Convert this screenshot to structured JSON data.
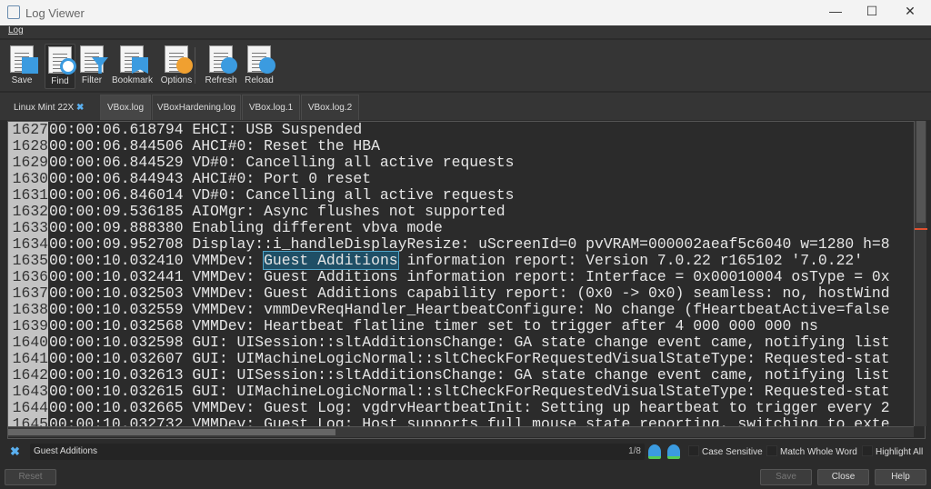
{
  "window": {
    "title": "Log Viewer",
    "minimize": "—",
    "maximize": "☐",
    "close": "✕"
  },
  "menu": {
    "log": "Log"
  },
  "toolbar": {
    "save": "Save",
    "find": "Find",
    "filter": "Filter",
    "bookmark": "Bookmark",
    "options": "Options",
    "refresh": "Refresh",
    "reload": "Reload"
  },
  "vm_name": "Linux Mint 22X",
  "tabs": [
    "VBox.log",
    "VBoxHardening.log",
    "VBox.log.1",
    "VBox.log.2"
  ],
  "log_lines": [
    {
      "n": "1627",
      "t": "00:00:06.618794 EHCI: USB Suspended"
    },
    {
      "n": "1628",
      "t": "00:00:06.844506 AHCI#0: Reset the HBA"
    },
    {
      "n": "1629",
      "t": "00:00:06.844529 VD#0: Cancelling all active requests"
    },
    {
      "n": "1630",
      "t": "00:00:06.844943 AHCI#0: Port 0 reset"
    },
    {
      "n": "1631",
      "t": "00:00:06.846014 VD#0: Cancelling all active requests"
    },
    {
      "n": "1632",
      "t": "00:00:09.536185 AIOMgr: Async flushes not supported"
    },
    {
      "n": "1633",
      "t": "00:00:09.888380 Enabling different vbva mode"
    },
    {
      "n": "1634",
      "t": "00:00:09.952708 Display::i_handleDisplayResize: uScreenId=0 pvVRAM=000002aeaf5c6040 w=1280 h=8"
    },
    {
      "n": "1635",
      "pre": "00:00:10.032410 VMMDev: ",
      "hl": "Guest Additions",
      "post": " information report: Version 7.0.22 r165102 '7.0.22'"
    },
    {
      "n": "1636",
      "t": "00:00:10.032441 VMMDev: Guest Additions information report: Interface = 0x00010004 osType = 0x"
    },
    {
      "n": "1637",
      "t": "00:00:10.032503 VMMDev: Guest Additions capability report: (0x0 -> 0x0) seamless: no, hostWind"
    },
    {
      "n": "1638",
      "t": "00:00:10.032559 VMMDev: vmmDevReqHandler_HeartbeatConfigure: No change (fHeartbeatActive=false"
    },
    {
      "n": "1639",
      "t": "00:00:10.032568 VMMDev: Heartbeat flatline timer set to trigger after 4 000 000 000 ns"
    },
    {
      "n": "1640",
      "t": "00:00:10.032598 GUI: UISession::sltAdditionsChange: GA state change event came, notifying list"
    },
    {
      "n": "1641",
      "t": "00:00:10.032607 GUI: UIMachineLogicNormal::sltCheckForRequestedVisualStateType: Requested-stat"
    },
    {
      "n": "1642",
      "t": "00:00:10.032613 GUI: UISession::sltAdditionsChange: GA state change event came, notifying list"
    },
    {
      "n": "1643",
      "t": "00:00:10.032615 GUI: UIMachineLogicNormal::sltCheckForRequestedVisualStateType: Requested-stat"
    },
    {
      "n": "1644",
      "t": "00:00:10.032665 VMMDev: Guest Log: vgdrvHeartbeatInit: Setting up heartbeat to trigger every 2"
    },
    {
      "n": "1645",
      "t": "00:00:10.032732 VMMDev: Guest Log: Host supports full mouse state reporting, switching to exte"
    }
  ],
  "find": {
    "value": "Guest Additions",
    "count": "1/8",
    "case_sensitive": "Case Sensitive",
    "match_whole_word": "Match Whole Word",
    "highlight_all": "Highlight All"
  },
  "buttons": {
    "reset": "Reset",
    "save": "Save",
    "close": "Close",
    "help": "Help"
  }
}
